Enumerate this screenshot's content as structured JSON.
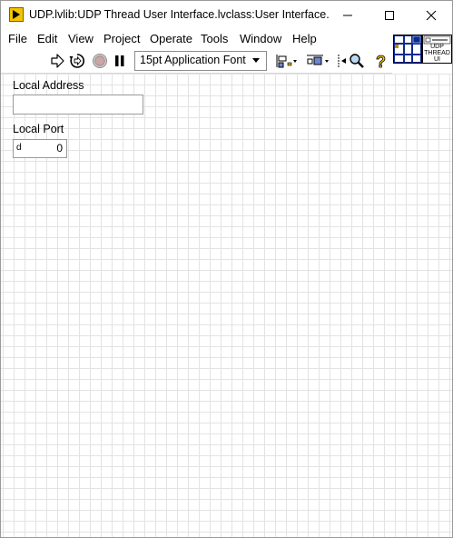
{
  "window": {
    "title": "UDP.lvlib:UDP Thread User Interface.lvclass:User Interface.vi ...",
    "icon": "labview-run-arrow-icon",
    "controls": [
      "minimize-icon",
      "maximize-icon",
      "close-icon"
    ]
  },
  "menu": {
    "items": [
      {
        "label": "File"
      },
      {
        "label": "Edit"
      },
      {
        "label": "View"
      },
      {
        "label": "Project"
      },
      {
        "label": "Operate"
      },
      {
        "label": "Tools"
      },
      {
        "label": "Window"
      },
      {
        "label": "Help"
      }
    ]
  },
  "toolbar": {
    "buttons": [
      "run-arrow-icon",
      "run-continuously-icon",
      "abort-icon",
      "pause-icon"
    ],
    "font_select": "15pt Application Font",
    "tools": [
      "align-objects-icon",
      "distribute-objects-icon",
      "resize-objects-icon",
      "search-icon",
      "context-help-icon"
    ]
  },
  "vi_icon": {
    "lines": [
      "UDP",
      "THREAD",
      "UI"
    ]
  },
  "front_panel": {
    "local_address": {
      "label": "Local Address",
      "value": ""
    },
    "local_port": {
      "label": "Local Port",
      "radix": "d",
      "value": "0"
    }
  },
  "colors": {
    "grid": "#e3e3e3",
    "connector_blue": "#0b2a8c",
    "run_arrow_yellow": "#f5c400",
    "context_help_yellow": "#f2c400"
  }
}
